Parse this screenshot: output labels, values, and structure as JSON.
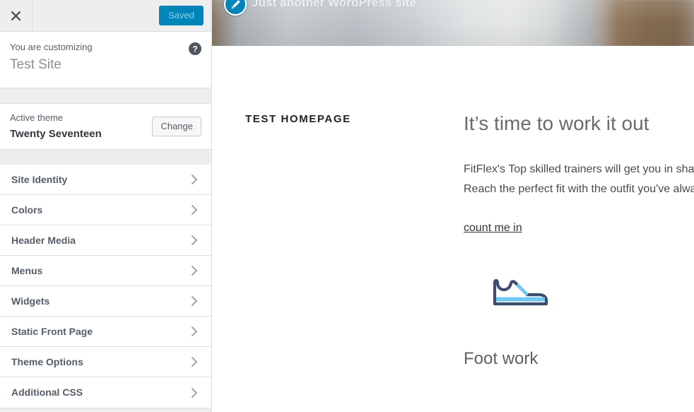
{
  "customizer": {
    "close_icon": "close-icon",
    "save_label": "Saved",
    "info": {
      "eyebrow": "You are customizing",
      "title": "Test Site",
      "help_icon": "help-icon"
    },
    "theme": {
      "label": "Active theme",
      "name": "Twenty Seventeen",
      "change_label": "Change"
    },
    "sections": [
      {
        "label": "Site Identity",
        "icon": "chevron-right-icon"
      },
      {
        "label": "Colors",
        "icon": "chevron-right-icon"
      },
      {
        "label": "Header Media",
        "icon": "chevron-right-icon"
      },
      {
        "label": "Menus",
        "icon": "chevron-right-icon"
      },
      {
        "label": "Widgets",
        "icon": "chevron-right-icon"
      },
      {
        "label": "Static Front Page",
        "icon": "chevron-right-icon"
      },
      {
        "label": "Theme Options",
        "icon": "chevron-right-icon"
      },
      {
        "label": "Additional CSS",
        "icon": "chevron-right-icon"
      }
    ]
  },
  "preview": {
    "tagline": "Just another WordPress site",
    "edit_icon": "pencil-edit-icon",
    "site_title": "TEST HOMEPAGE",
    "heading": "It’s time to work it out",
    "paragraph_line1": "FitFlex's Top skilled trainers will get you in shape",
    "paragraph_line2": "Reach the perfect fit with the outfit you've always",
    "cta_label": "count me in",
    "shoe_icon": "sneaker-icon",
    "section_heading": "Foot work"
  },
  "colors": {
    "accent_blue": "#0085ba",
    "sidebar_bg": "#eeeeee",
    "panel_bg": "#ffffff",
    "border": "#dddddd",
    "text_dark": "#32373c",
    "text_muted": "#555d66",
    "chevron": "#a0a5aa",
    "shoe_navy": "#3f4d6b",
    "shoe_blue": "#6ec8f0"
  }
}
